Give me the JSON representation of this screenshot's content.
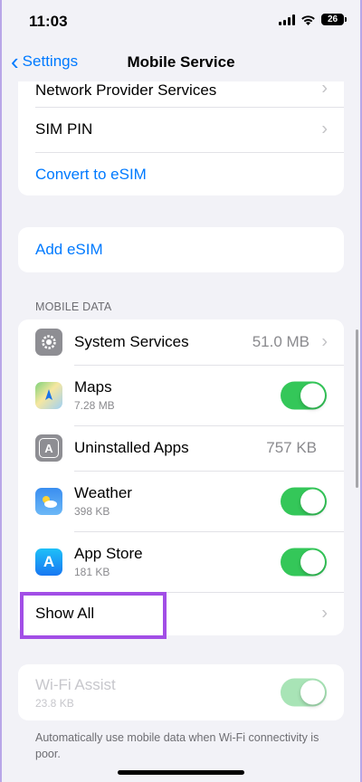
{
  "status": {
    "time": "11:03",
    "battery": "26"
  },
  "nav": {
    "back_label": "Settings",
    "title": "Mobile Service"
  },
  "top_group": {
    "items": [
      {
        "label": "Network Provider Services"
      },
      {
        "label": "SIM PIN"
      },
      {
        "label": "Convert to eSIM"
      }
    ]
  },
  "add_esim": {
    "label": "Add eSIM"
  },
  "mobile_data": {
    "header": "MOBILE DATA",
    "rows": [
      {
        "label": "System Services",
        "value": "51.0 MB",
        "icon": "gear-icon"
      },
      {
        "label": "Maps",
        "sub": "7.28 MB",
        "icon": "maps-icon",
        "toggle": true
      },
      {
        "label": "Uninstalled Apps",
        "value": "757 KB",
        "icon": "app-store-icon"
      },
      {
        "label": "Weather",
        "sub": "398 KB",
        "icon": "weather-icon",
        "toggle": true
      },
      {
        "label": "App Store",
        "sub": "181 KB",
        "icon": "app-store-icon",
        "toggle": true
      },
      {
        "label": "Show All"
      }
    ]
  },
  "wifi_assist": {
    "label": "Wi-Fi Assist",
    "sub": "23.8 KB",
    "toggle": true,
    "footnote": "Automatically use mobile data when Wi-Fi connectivity is poor."
  },
  "colors": {
    "accent": "#007aff",
    "toggle_on": "#34c759",
    "highlight": "#a24ee6"
  }
}
